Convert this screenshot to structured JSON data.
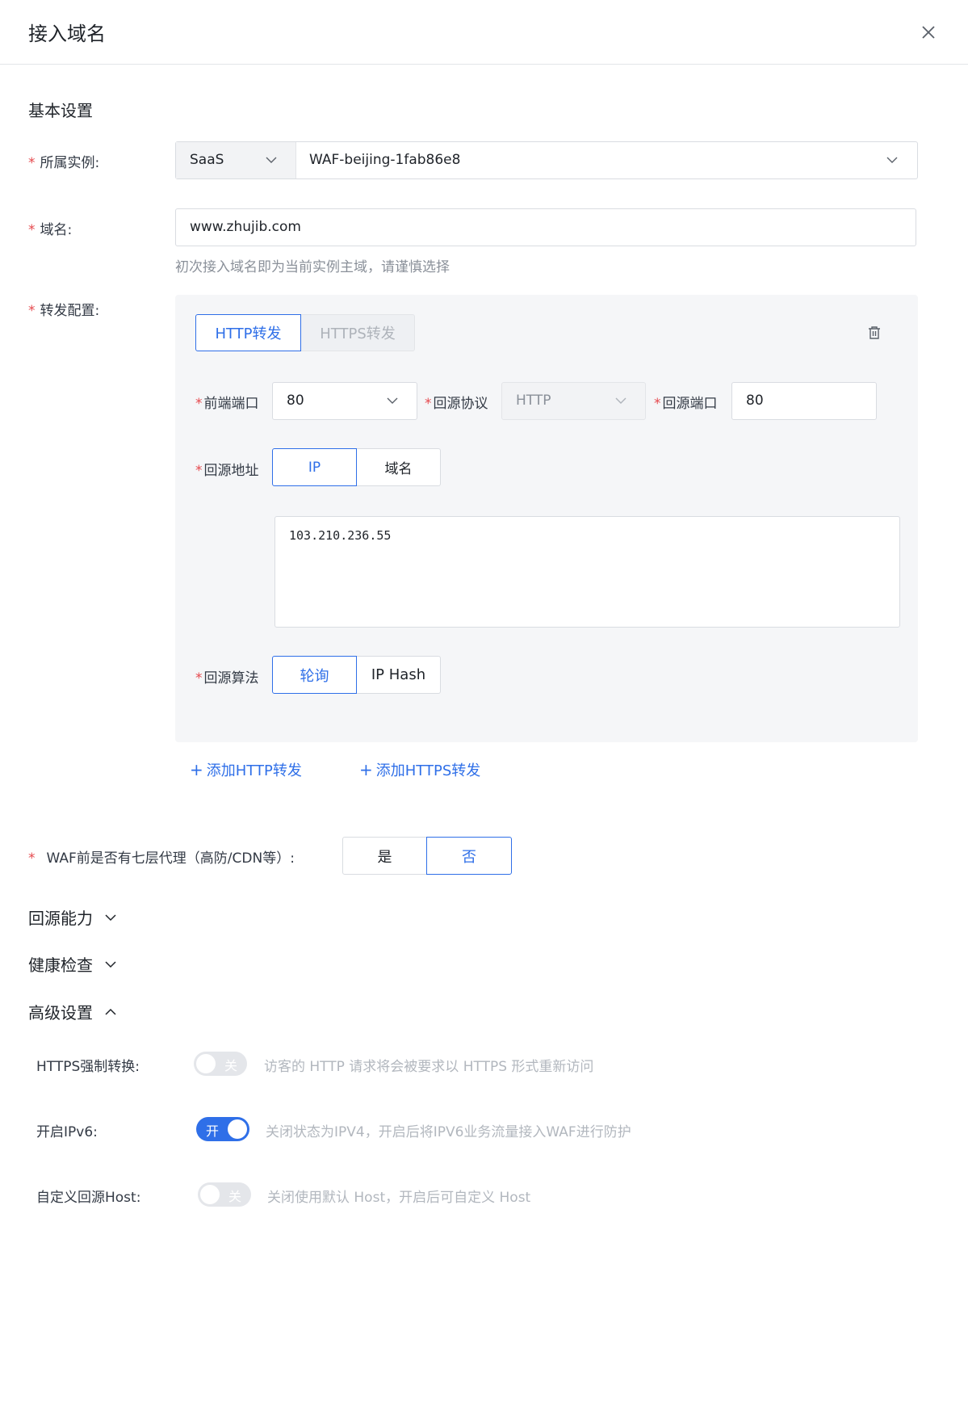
{
  "header": {
    "title": "接入域名"
  },
  "basic": {
    "title": "基本设置",
    "instance_label": "所属实例:",
    "instance_type": "SaaS",
    "instance_name": "WAF-beijing-1fab86e8",
    "domain_label": "域名:",
    "domain_value": "www.zhujib.com",
    "domain_hint": "初次接入域名即为当前实例主域，请谨慎选择",
    "forward_label": "转发配置:"
  },
  "forward": {
    "tab_http": "HTTP转发",
    "tab_https": "HTTPS转发",
    "frontend_port_label": "前端端口",
    "frontend_port_value": "80",
    "origin_protocol_label": "回源协议",
    "origin_protocol_value": "HTTP",
    "origin_port_label": "回源端口",
    "origin_port_value": "80",
    "origin_addr_label": "回源地址",
    "addr_ip": "IP",
    "addr_domain": "域名",
    "ip_list": "103.210.236.55",
    "algo_label": "回源算法",
    "algo_rr": "轮询",
    "algo_hash": "IP Hash",
    "add_http": "添加HTTP转发",
    "add_https": "添加HTTPS转发"
  },
  "proxy": {
    "label": "WAF前是否有七层代理（高防/CDN等）:",
    "yes": "是",
    "no": "否"
  },
  "sections": {
    "origin_ability": "回源能力",
    "health_check": "健康检查",
    "advanced": "高级设置"
  },
  "advanced": {
    "https_force_label": "HTTPS强制转换:",
    "https_force_state": "关",
    "https_force_hint": "访客的 HTTP 请求将会被要求以 HTTPS 形式重新访问",
    "ipv6_label": "开启IPv6:",
    "ipv6_state": "开",
    "ipv6_hint": "关闭状态为IPV4，开启后将IPV6业务流量接入WAF进行防护",
    "host_label": "自定义回源Host:",
    "host_state": "关",
    "host_hint": "关闭使用默认 Host，开启后可自定义 Host"
  },
  "colors": {
    "primary": "#2f6fe8",
    "required": "#e5484d",
    "panel_bg": "#f5f6f8"
  }
}
